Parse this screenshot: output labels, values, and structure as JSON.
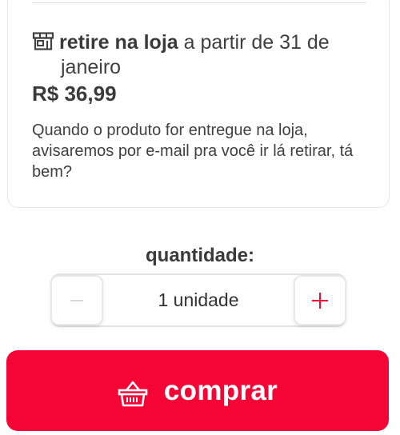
{
  "pickup": {
    "icon": "store-icon",
    "bold_text": "retire na loja",
    "text_line1": " a partir de 31 de",
    "text_line2": "janeiro"
  },
  "price": "R$ 36,99",
  "notice": "Quando o produto for entregue na loja, avisaremos por e-mail pra você ir lá retirar, tá bem?",
  "quantity": {
    "label": "quantidade:",
    "value": "1 unidade",
    "decrement_icon": "minus-icon",
    "increment_icon": "plus-icon",
    "decrement_color": "#d9d9d9",
    "increment_color": "#f50535"
  },
  "buy_button": {
    "label": "comprar",
    "icon": "basket-icon",
    "color": "#f50535"
  }
}
